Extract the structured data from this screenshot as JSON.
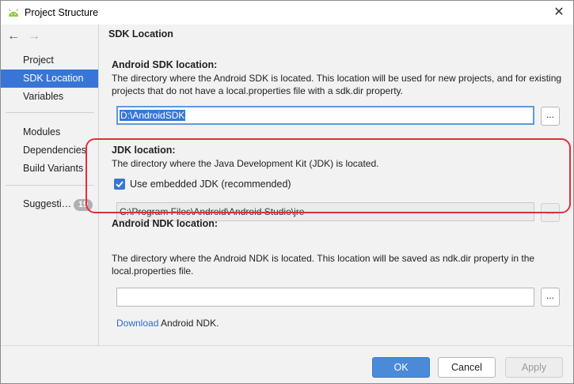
{
  "window": {
    "title": "Project Structure",
    "app_icon": "android-icon",
    "close_glyph": "✕"
  },
  "nav": {
    "back_glyph": "←",
    "forward_glyph": "→"
  },
  "sidebar": {
    "items": [
      {
        "label": "Project",
        "selected": false
      },
      {
        "label": "SDK Location",
        "selected": true
      },
      {
        "label": "Variables",
        "selected": false
      },
      {
        "label": "Modules",
        "selected": false
      },
      {
        "label": "Dependencies",
        "selected": false
      },
      {
        "label": "Build Variants",
        "selected": false
      },
      {
        "label": "Suggesti…",
        "selected": false
      }
    ],
    "suggestions_badge": "19"
  },
  "main": {
    "title": "SDK Location",
    "sdk": {
      "heading": "Android SDK location:",
      "description_line1": "The directory where the Android SDK is located. This location will be used for new projects, and for existing",
      "description_line2": "projects that do not have a local.properties file with a sdk.dir property.",
      "value": "D:\\AndroidSDK",
      "browse_label": "..."
    },
    "jdk": {
      "heading": "JDK location:",
      "description": "The directory where the Java Development Kit (JDK) is located.",
      "checkbox_label": "Use embedded JDK (recommended)",
      "checkbox_checked": true,
      "value": "C:\\Program Files\\Android\\Android Studio\\jre",
      "browse_label": "..."
    },
    "ndk": {
      "heading": "Android NDK location:",
      "description_line1": "The directory where the Android NDK is located. This location will be saved as ndk.dir property in the",
      "description_line2": "local.properties file.",
      "value": "",
      "browse_label": "...",
      "download_link": "Download",
      "download_suffix": " Android NDK."
    }
  },
  "footer": {
    "ok_label": "OK",
    "cancel_label": "Cancel",
    "apply_label": "Apply"
  },
  "colors": {
    "selection": "#3875d7",
    "highlight_box": "#e0303a",
    "link": "#2a6bc9",
    "ok_button": "#4a8ad9"
  }
}
